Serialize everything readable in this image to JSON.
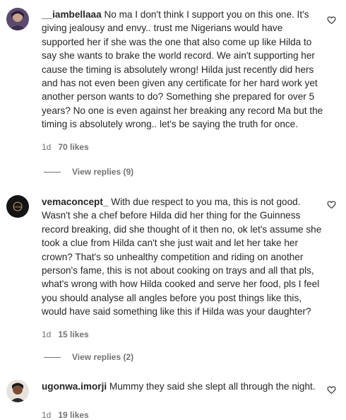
{
  "comments": [
    {
      "username": "__iambellaaa",
      "text": "No ma I don't think I support you on this one. It's giving jealousy and envy.. trust me Nigerians would have supported her if she was the one that also come up like Hilda to say she wants to brake the world record. We ain't supporting her cause the timing is absolutely wrong! Hilda just recently did hers and has not even been given any certificate for her hard work yet another person wants to do? Something she prepared for over 5 years? No one is even against her breaking any record Ma but the timing is absolutely wrong.. let's be saying the truth for once.",
      "time": "1d",
      "likes": "70 likes",
      "replies": "View replies (9)"
    },
    {
      "username": "vemaconcept_",
      "text": "With due respect to you ma, this is not good. Wasn't she a chef before Hilda did her thing for the Guinness record breaking, did she thought of it then no, ok let's assume she took a clue from Hilda can't she just wait and let her take her crown? That's so unhealthy competition and riding on another person's fame, this is not about cooking on trays and all that pls, what's wrong with how Hilda cooked and serve her food, pls I feel you should analyse all angles before you post things like this, would have said something like this if Hilda was your daughter?",
      "time": "1d",
      "likes": "15 likes",
      "replies": "View replies (2)"
    },
    {
      "username": "ugonwa.imorji",
      "text": "Mummy they said she slept all through the night.",
      "time": "1d",
      "likes": "19 likes"
    }
  ],
  "icons": {
    "like": "heart-outline-icon",
    "avatar_logo_text": "vema"
  }
}
